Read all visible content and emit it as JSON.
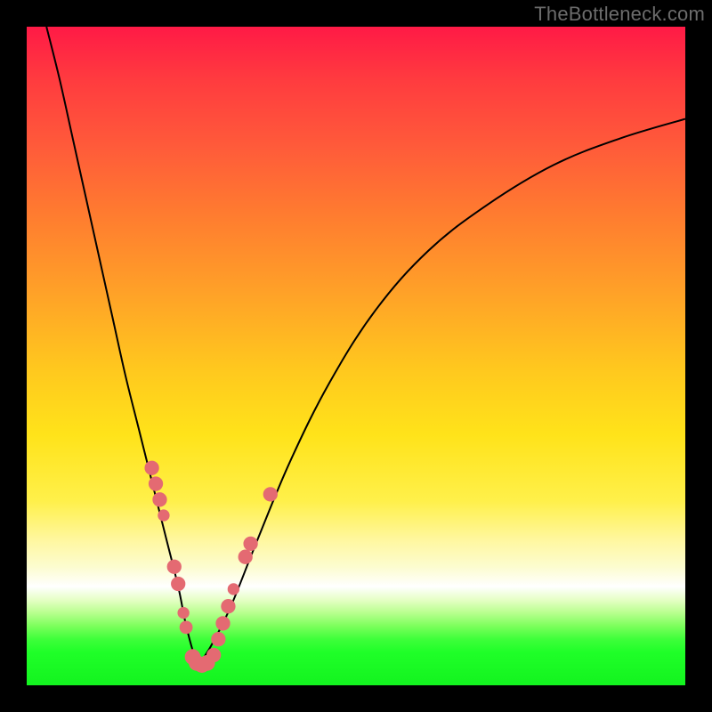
{
  "watermark": "TheBottleneck.com",
  "chart_data": {
    "type": "line",
    "title": "",
    "xlabel": "",
    "ylabel": "",
    "xlim": [
      0,
      100
    ],
    "ylim": [
      0,
      100
    ],
    "grid": false,
    "legend": false,
    "background": {
      "type": "vertical-gradient",
      "stops": [
        {
          "pos": 0,
          "color": "#ff1a46"
        },
        {
          "pos": 18,
          "color": "#ff5a3a"
        },
        {
          "pos": 40,
          "color": "#ffa028"
        },
        {
          "pos": 62,
          "color": "#ffe31a"
        },
        {
          "pos": 82,
          "color": "#fcfccf"
        },
        {
          "pos": 85,
          "color": "#ffffff"
        },
        {
          "pos": 93,
          "color": "#3eff3a"
        },
        {
          "pos": 100,
          "color": "#13f31f"
        }
      ]
    },
    "series": [
      {
        "name": "left-branch",
        "x": [
          3,
          5,
          7,
          9,
          11,
          13,
          15,
          17,
          19,
          21,
          23,
          24,
          25,
          26
        ],
        "y": [
          100,
          92,
          83,
          74,
          65,
          56,
          47,
          39,
          31,
          23,
          15,
          10,
          6,
          3
        ],
        "stroke": "#000000"
      },
      {
        "name": "right-branch",
        "x": [
          26,
          28,
          31,
          35,
          40,
          46,
          53,
          61,
          70,
          80,
          90,
          100
        ],
        "y": [
          3,
          6,
          12,
          22,
          34,
          46,
          57,
          66,
          73,
          79,
          83,
          86
        ],
        "stroke": "#000000"
      }
    ],
    "markers": [
      {
        "x": 19.0,
        "y": 33.0,
        "r": 1.1
      },
      {
        "x": 19.6,
        "y": 30.6,
        "r": 1.1
      },
      {
        "x": 20.2,
        "y": 28.2,
        "r": 1.1
      },
      {
        "x": 20.8,
        "y": 25.8,
        "r": 0.9
      },
      {
        "x": 22.4,
        "y": 18.0,
        "r": 1.1
      },
      {
        "x": 23.0,
        "y": 15.4,
        "r": 1.1
      },
      {
        "x": 23.8,
        "y": 11.0,
        "r": 0.9
      },
      {
        "x": 24.2,
        "y": 8.8,
        "r": 1.0
      },
      {
        "x": 25.2,
        "y": 4.3,
        "r": 1.2
      },
      {
        "x": 25.8,
        "y": 3.4,
        "r": 1.2
      },
      {
        "x": 26.6,
        "y": 3.1,
        "r": 1.2
      },
      {
        "x": 27.4,
        "y": 3.4,
        "r": 1.2
      },
      {
        "x": 28.4,
        "y": 4.6,
        "r": 1.1
      },
      {
        "x": 29.1,
        "y": 7.0,
        "r": 1.1
      },
      {
        "x": 29.8,
        "y": 9.4,
        "r": 1.1
      },
      {
        "x": 30.6,
        "y": 12.0,
        "r": 1.1
      },
      {
        "x": 31.4,
        "y": 14.6,
        "r": 0.9
      },
      {
        "x": 33.2,
        "y": 19.5,
        "r": 1.1
      },
      {
        "x": 34.0,
        "y": 21.5,
        "r": 1.1
      },
      {
        "x": 37.0,
        "y": 29.0,
        "r": 1.1
      }
    ],
    "marker_color": "#e46a72"
  }
}
